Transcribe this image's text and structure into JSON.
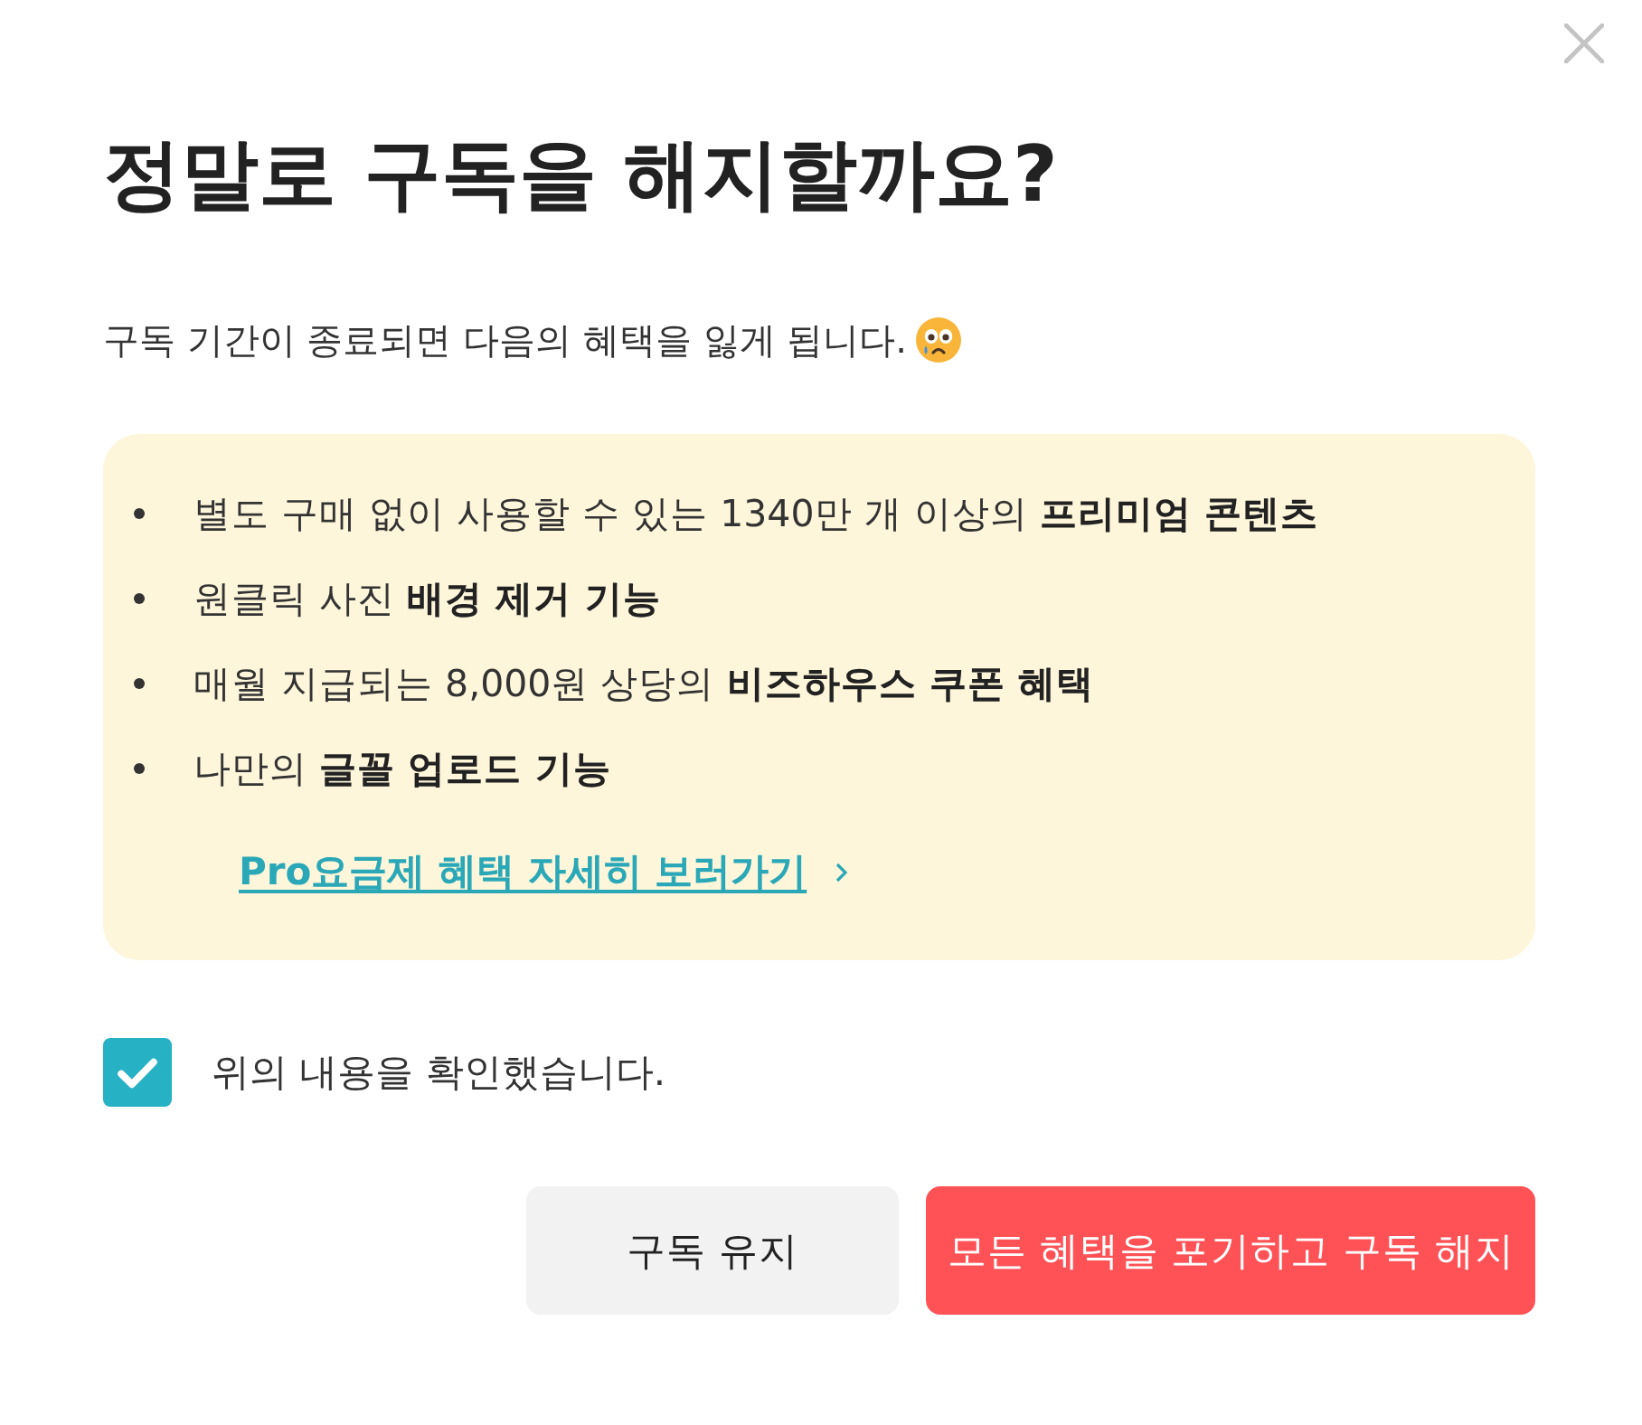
{
  "dialog": {
    "title": "정말로 구독을 해지할까요?",
    "message": "구독 기간이 종료되면 다음의 혜택을 잃게 됩니다.",
    "benefits": [
      "별도 구매 없이 사용할 수 있는 1340만 개 이상의 **프리미엄 콘텐츠**",
      "원클릭 사진 **배경 제거 기능**",
      "매월 지급되는 8,000원 상당의 **비즈하우스 쿠폰 혜택**",
      "나만의 **글꼴 업로드 기능**"
    ],
    "link": "Pro요금제 혜택 자세히 보러가기",
    "confirm": {
      "label": "위의 내용을 확인했습니다.",
      "checked": true
    },
    "buttons": [
      {
        "label": "구독 유지",
        "kind": "secondary"
      },
      {
        "label": "모든 혜택을 포기하고 구독 해지",
        "kind": "danger"
      }
    ]
  }
}
